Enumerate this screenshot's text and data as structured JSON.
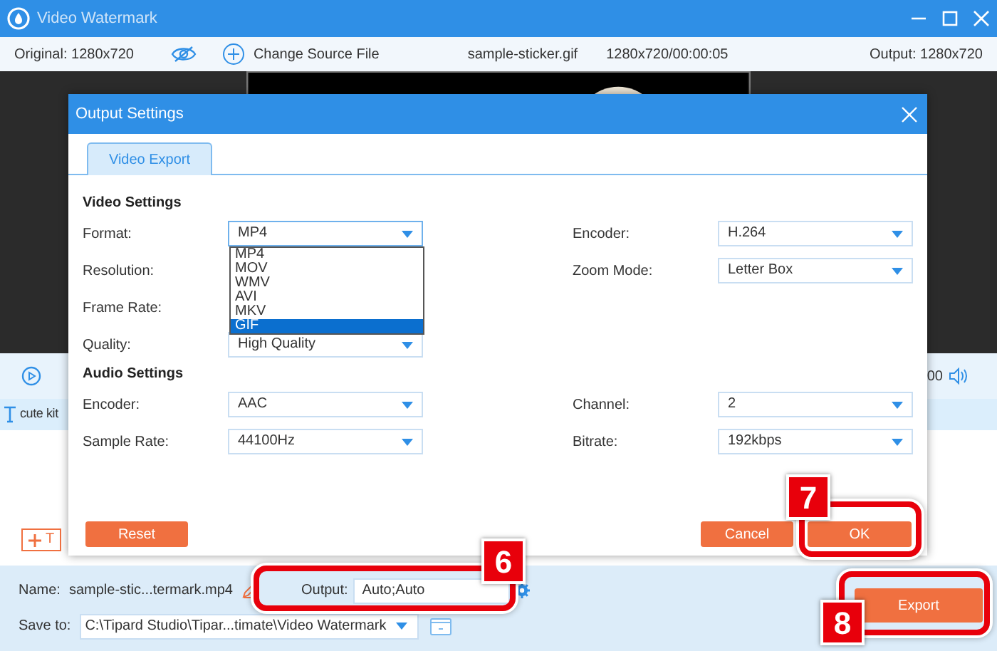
{
  "window": {
    "title": "Video Watermark"
  },
  "top_bar": {
    "original": "Original: 1280x720",
    "change_source": "Change Source File",
    "file_name": "sample-sticker.gif",
    "file_info": "1280x720/00:00:05",
    "output": "Output: 1280x720"
  },
  "timeline": {
    "time": "00",
    "layer_label": "cute kit",
    "add_button": "T"
  },
  "bottom": {
    "name_label": "Name:",
    "name_value": "sample-stic...termark.mp4",
    "output_label": "Output:",
    "output_value": "Auto;Auto",
    "output_callout": "6",
    "save_label": "Save to:",
    "save_path": "C:\\Tipard Studio\\Tipar...timate\\Video Watermark",
    "export": "Export",
    "export_callout": "8"
  },
  "dialog": {
    "title": "Output Settings",
    "tabs": [
      {
        "label": "Video Export",
        "selected": true
      }
    ],
    "video_title": "Video Settings",
    "video_left": [
      {
        "label": "Format:",
        "value": "MP4",
        "open": true
      },
      {
        "label": "Resolution:"
      },
      {
        "label": "Frame Rate:"
      },
      {
        "label": "Quality:",
        "value": "High Quality"
      }
    ],
    "video_right": [
      {
        "label": "Encoder:",
        "value": "H.264"
      },
      {
        "label": "Zoom Mode:",
        "value": "Letter Box"
      }
    ],
    "format_options": [
      {
        "label": "MP4",
        "selected": false
      },
      {
        "label": "MOV",
        "selected": false
      },
      {
        "label": "WMV",
        "selected": false
      },
      {
        "label": "AVI",
        "selected": false
      },
      {
        "label": "MKV",
        "selected": false
      },
      {
        "label": "GIF",
        "selected": true
      }
    ],
    "audio_title": "Audio Settings",
    "audio_left": [
      {
        "label": "Encoder:",
        "value": "AAC"
      },
      {
        "label": "Sample Rate:",
        "value": "44100Hz"
      }
    ],
    "audio_right": [
      {
        "label": "Channel:",
        "value": "2"
      },
      {
        "label": "Bitrate:",
        "value": "192kbps"
      }
    ],
    "reset": "Reset",
    "cancel": "Cancel",
    "ok": "OK",
    "ok_callout": "7"
  }
}
